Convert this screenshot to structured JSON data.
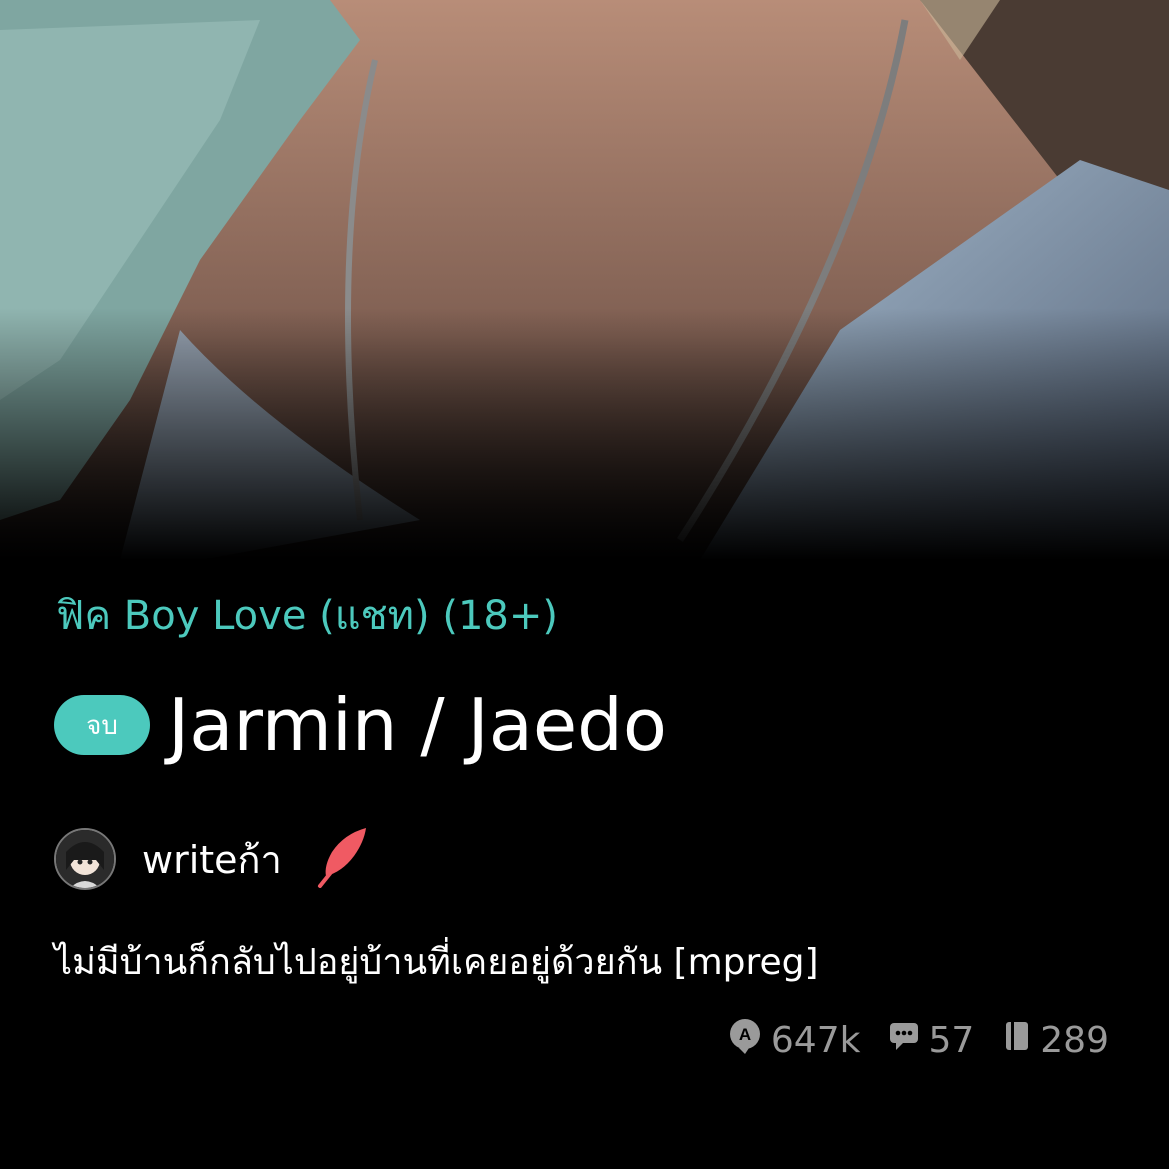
{
  "cover": {
    "alt_icon": "cover-photo"
  },
  "category": "ฟิค Boy Love (แชท) (18+)",
  "badge": "จบ",
  "title": "Jarmin / Jaedo",
  "author": {
    "name": "writeก้า",
    "avatar_icon": "avatar-icon",
    "badge_icon": "feather-icon"
  },
  "description": "ไม่มีบ้านก็กลับไปอยู่บ้านที่เคยอยู่ด้วยกัน [mpreg]",
  "stats": {
    "views": "647k",
    "comments": "57",
    "chapters": "289"
  },
  "colors": {
    "accent": "#4cc9bd",
    "background": "#000000",
    "muted": "#9a9a9a",
    "feather": "#f05a63"
  }
}
